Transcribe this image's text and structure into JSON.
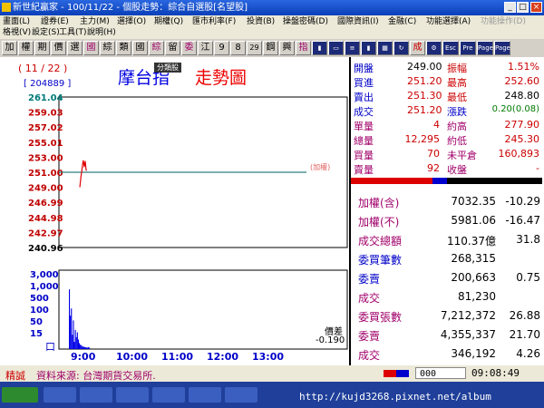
{
  "window": {
    "title": "新世紀贏家 - 100/11/22 - 個股走勢：綜合自選股[名望股]"
  },
  "menu": {
    "row1": [
      "畫面(L)",
      "證券(E)",
      "主力(M)",
      "選擇(O)",
      "期權(Q)",
      "匯市利率(F)",
      "投資(B)",
      "操盤密碼(D)",
      "國際資訊(I)",
      "金融(C)",
      "功能選擇(A)",
      "功能操作(D)"
    ],
    "row2": [
      "格視(V)",
      "設定(S)",
      "工具(T)",
      "說明(H)"
    ]
  },
  "toolbar": {
    "buttons": [
      "加",
      "權",
      "期",
      "價",
      "選",
      "國",
      "綜",
      "類",
      "國",
      "綜",
      "留",
      "委",
      "江",
      "9",
      "8",
      "29",
      "鋼",
      "興",
      "指"
    ],
    "icons": [
      "chart-icon",
      "monitor-icon",
      "list-icon",
      "chart2-icon",
      "grid-icon",
      "refresh-icon",
      "settings-icon"
    ],
    "icon_labels": [
      "成",
      "Esc",
      "Pre",
      "Page",
      "Page"
    ]
  },
  "chart": {
    "date_tag": "( 11 / 22 )",
    "volume_tag": "[ 204889 ]",
    "title": "摩台指",
    "title_suffix": "走勢圖",
    "dropdown": "分類股",
    "weighted_tag": "(加權)",
    "diff_label": "價差",
    "diff_value": "-0.190",
    "vol_unit": "口"
  },
  "chart_data": {
    "type": "line",
    "title": "摩台指 走勢圖",
    "xlabel": "",
    "ylabel": "",
    "x_ticks": [
      "9:00",
      "10:00",
      "11:00",
      "12:00",
      "13:00"
    ],
    "y_ticks": [
      261.04,
      259.03,
      257.02,
      255.01,
      253.0,
      251.0,
      249.0,
      246.99,
      244.98,
      242.97,
      240.96
    ],
    "ylim": [
      240.96,
      261.04
    ],
    "reference": 251.0,
    "volume_ticks": [
      "3,000",
      "1,000",
      "500",
      "100",
      "50",
      "15"
    ],
    "price_series": {
      "x_minutes": [
        0,
        1,
        2,
        3,
        4,
        5,
        6,
        7,
        8,
        9,
        10,
        11,
        12,
        13,
        14,
        15,
        16,
        17,
        18,
        19,
        20
      ],
      "values": [
        249.0,
        249.4,
        249.8,
        250.2,
        250.6,
        250.9,
        251.2,
        251.6,
        251.9,
        252.3,
        252.6,
        252.4,
        252.1,
        251.8,
        251.9,
        252.2,
        252.5,
        252.0,
        251.5,
        251.3,
        251.2
      ]
    },
    "volume_series": {
      "x_minutes": [
        0,
        1,
        2,
        3,
        4,
        5,
        6,
        7,
        8,
        9,
        10,
        11,
        12,
        13,
        14,
        15,
        16,
        17,
        18,
        19,
        20
      ],
      "values": [
        2500,
        1400,
        1700,
        600,
        1200,
        300,
        800,
        500,
        700,
        400,
        250,
        180,
        160,
        120,
        100,
        90,
        80,
        70,
        60,
        80,
        60
      ]
    }
  },
  "quote": [
    {
      "l": "開盤",
      "v": "249.00",
      "l2": "振幅",
      "v2": "1.51%"
    },
    {
      "l": "買進",
      "v": "251.20",
      "l2": "最高",
      "v2": "252.60"
    },
    {
      "l": "賣出",
      "v": "251.30",
      "l2": "最低",
      "v2": "248.80"
    },
    {
      "l": "成交",
      "v": "251.20",
      "l2": "漲跌",
      "v2": "0.20(0.08)"
    },
    {
      "l": "單量",
      "v": "4",
      "l2": "約高",
      "v2": "277.90"
    },
    {
      "l": "總量",
      "v": "12,295",
      "l2": "約低",
      "v2": "245.30"
    },
    {
      "l": "買量",
      "v": "70",
      "l2": "未平倉",
      "v2": "160,893"
    },
    {
      "l": "賣量",
      "v": "92",
      "l2": "收盤",
      "v2": "-"
    }
  ],
  "index": [
    {
      "l": "加權(含)",
      "v": "7032.35",
      "c": "-10.29"
    },
    {
      "l": "加權(不)",
      "v": "5981.06",
      "c": "-16.47"
    },
    {
      "l": "成交總額",
      "v": "110.37億",
      "c": "31.8"
    },
    {
      "l": "委買筆數",
      "v": "268,315",
      "c": ""
    },
    {
      "l": "委賣",
      "v": "200,663",
      "c": "0.75"
    },
    {
      "l": "成交",
      "v": "81,230",
      "c": ""
    },
    {
      "l": "委買張數",
      "v": "7,212,372",
      "c": "26.88"
    },
    {
      "l": "委賣",
      "v": "4,355,337",
      "c": "21.70"
    },
    {
      "l": "成交",
      "v": "346,192",
      "c": "4.26"
    }
  ],
  "status": {
    "tag": "精誠",
    "source": "資料來源: 台灣期貨交易所.",
    "input": "000",
    "time": "09:08:49"
  },
  "watermark": "http://kujd3268.pixnet.net/album",
  "colors": {
    "up": "#e00000",
    "down": "#007a00",
    "reference": "#2f7f7f",
    "volume": "#0000e8",
    "text_red": "#b0005a"
  }
}
